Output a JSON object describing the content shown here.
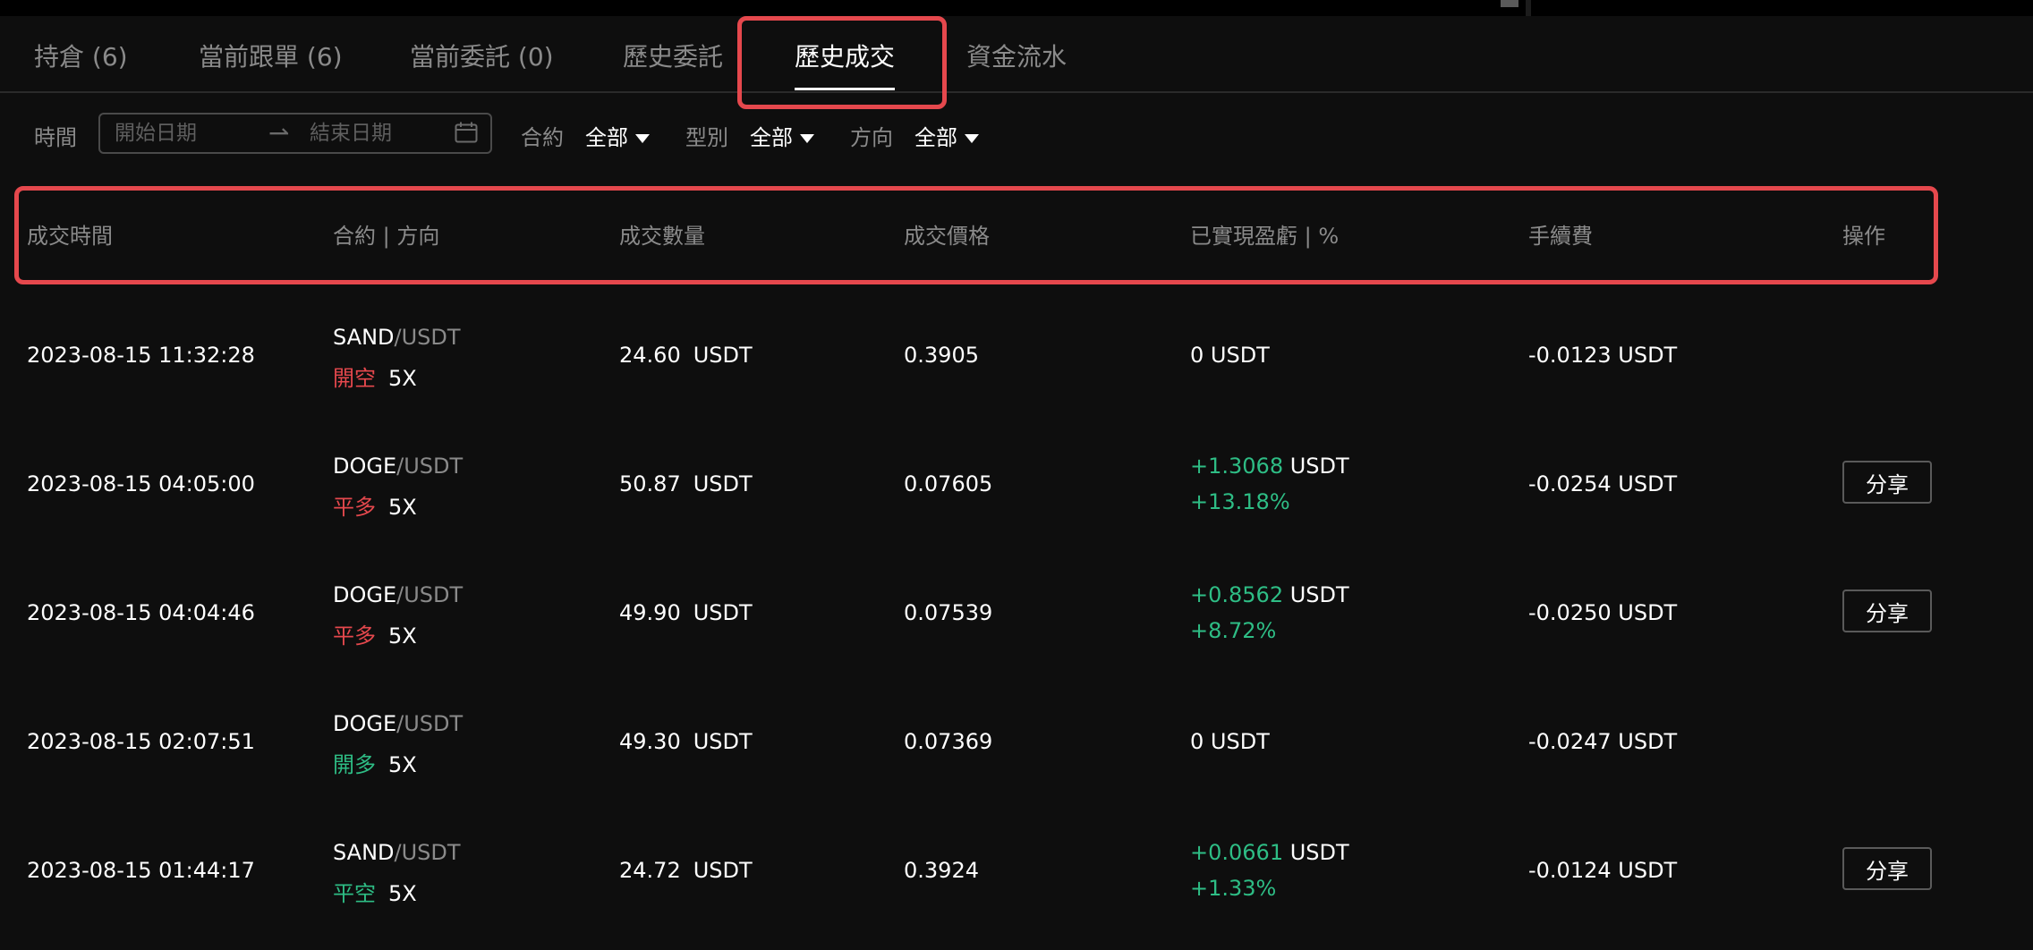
{
  "tabs": [
    {
      "label": "持倉 (6)"
    },
    {
      "label": "當前跟單 (6)"
    },
    {
      "label": "當前委託 (0)"
    },
    {
      "label": "歷史委託"
    },
    {
      "label": "歷史成交"
    },
    {
      "label": "資金流水"
    }
  ],
  "active_tab_index": 4,
  "filters": {
    "time_label": "時間",
    "start_placeholder": "開始日期",
    "end_placeholder": "結束日期",
    "contract_label": "合約",
    "contract_value": "全部",
    "type_label": "型別",
    "type_value": "全部",
    "direction_label": "方向",
    "direction_value": "全部"
  },
  "columns": [
    "成交時間",
    "合約 | 方向",
    "成交數量",
    "成交價格",
    "已實現盈虧 | %",
    "手續費",
    "操作"
  ],
  "rows": [
    {
      "time": "2023-08-15 11:32:28",
      "base": "SAND",
      "quote": "/USDT",
      "side": "開空",
      "side_color": "#e5484d",
      "leverage": "5X",
      "qty": "24.60",
      "qty_unit": "USDT",
      "price": "0.3905",
      "pnl": "0 USDT",
      "pnl_unit": "",
      "pnl_pct": "",
      "fee": "-0.0123 USDT",
      "share": ""
    },
    {
      "time": "2023-08-15 04:05:00",
      "base": "DOGE",
      "quote": "/USDT",
      "side": "平多",
      "side_color": "#e5484d",
      "leverage": "5X",
      "qty": "50.87",
      "qty_unit": "USDT",
      "price": "0.07605",
      "pnl": "+1.3068",
      "pnl_unit": " USDT",
      "pnl_pct": "+13.18%",
      "fee": "-0.0254 USDT",
      "share": "分享"
    },
    {
      "time": "2023-08-15 04:04:46",
      "base": "DOGE",
      "quote": "/USDT",
      "side": "平多",
      "side_color": "#e5484d",
      "leverage": "5X",
      "qty": "49.90",
      "qty_unit": "USDT",
      "price": "0.07539",
      "pnl": "+0.8562",
      "pnl_unit": " USDT",
      "pnl_pct": "+8.72%",
      "fee": "-0.0250 USDT",
      "share": "分享"
    },
    {
      "time": "2023-08-15 02:07:51",
      "base": "DOGE",
      "quote": "/USDT",
      "side": "開多",
      "side_color": "#2ebd85",
      "leverage": "5X",
      "qty": "49.30",
      "qty_unit": "USDT",
      "price": "0.07369",
      "pnl": "0 USDT",
      "pnl_unit": "",
      "pnl_pct": "",
      "fee": "-0.0247 USDT",
      "share": ""
    },
    {
      "time": "2023-08-15 01:44:17",
      "base": "SAND",
      "quote": "/USDT",
      "side": "平空",
      "side_color": "#2ebd85",
      "leverage": "5X",
      "qty": "24.72",
      "qty_unit": "USDT",
      "price": "0.3924",
      "pnl": "+0.0661",
      "pnl_unit": " USDT",
      "pnl_pct": "+1.33%",
      "fee": "-0.0124 USDT",
      "share": "分享"
    }
  ],
  "colors": {
    "background": "#0e0e0e",
    "highlight": "#e5484d",
    "profit": "#2ebd85",
    "loss": "#e5484d",
    "muted": "#8a8a8a"
  }
}
